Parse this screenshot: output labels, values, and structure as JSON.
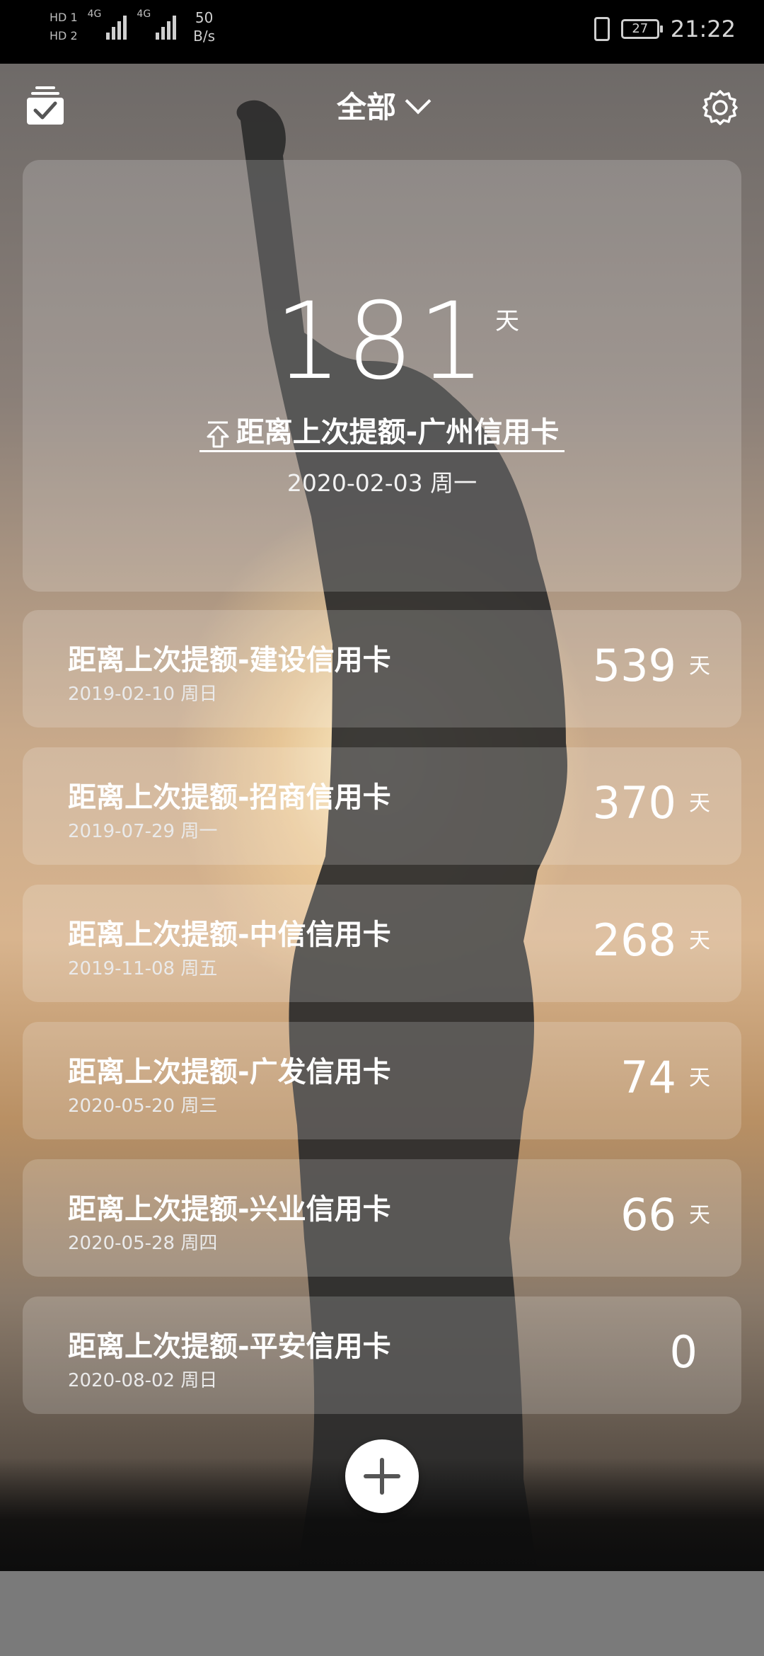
{
  "status_bar": {
    "sim1_label": "HD",
    "sim1_index": "1",
    "sim2_label": "HD",
    "sim2_index": "2",
    "network1": "4G",
    "network2": "4G",
    "speed_value": "50",
    "speed_unit": "B/s",
    "battery": "27",
    "time": "21:22"
  },
  "header": {
    "title": "全部",
    "left_icon": "task-check-icon",
    "right_icon": "gear-icon"
  },
  "hero": {
    "days": "181",
    "unit": "天",
    "title": "距离上次提额-广州信用卡",
    "date": "2020-02-03 周一",
    "pin_icon": "pin-top-icon"
  },
  "items": [
    {
      "title": "距离上次提额-建设信用卡",
      "date": "2019-02-10 周日",
      "days": "539",
      "unit": "天"
    },
    {
      "title": "距离上次提额-招商信用卡",
      "date": "2019-07-29 周一",
      "days": "370",
      "unit": "天"
    },
    {
      "title": "距离上次提额-中信信用卡",
      "date": "2019-11-08 周五",
      "days": "268",
      "unit": "天"
    },
    {
      "title": "距离上次提额-广发信用卡",
      "date": "2020-05-20 周三",
      "days": "74",
      "unit": "天"
    },
    {
      "title": "距离上次提额-兴业信用卡",
      "date": "2020-05-28 周四",
      "days": "66",
      "unit": "天"
    },
    {
      "title": "距离上次提额-平安信用卡",
      "date": "2020-08-02 周日",
      "days": "0",
      "unit": ""
    }
  ],
  "fab_icon": "plus-icon",
  "colors": {
    "card_overlay": "rgba(255,255,255,0.18)",
    "text": "#ffffff",
    "status_bg": "#000000",
    "nav_bg": "#7a7a7a"
  }
}
